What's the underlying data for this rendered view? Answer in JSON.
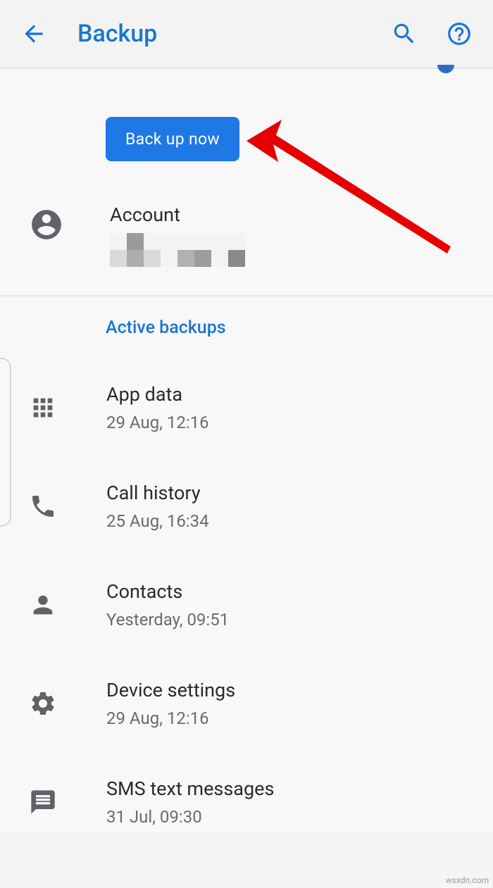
{
  "header": {
    "title": "Backup"
  },
  "primary_action": {
    "label": "Back up now"
  },
  "account": {
    "label": "Account"
  },
  "active_section": {
    "header": "Active backups",
    "items": [
      {
        "title": "App data",
        "sub": "29 Aug, 12:16"
      },
      {
        "title": "Call history",
        "sub": "25 Aug, 16:34"
      },
      {
        "title": "Contacts",
        "sub": "Yesterday, 09:51"
      },
      {
        "title": "Device settings",
        "sub": "29 Aug, 12:16"
      },
      {
        "title": "SMS text messages",
        "sub": "31 Jul, 09:30"
      }
    ]
  },
  "watermark": "wsxdn.com"
}
